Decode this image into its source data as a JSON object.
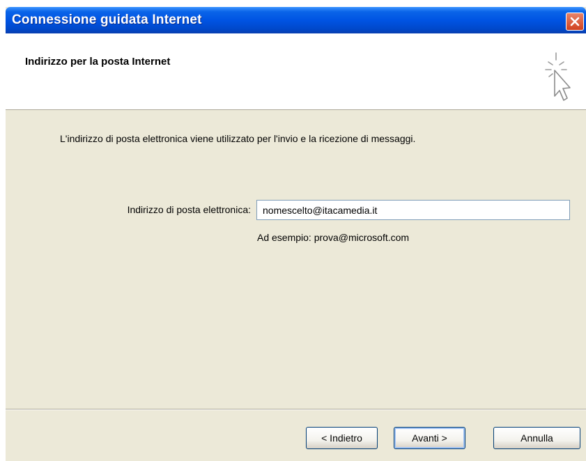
{
  "window": {
    "title": "Connessione guidata Internet"
  },
  "header": {
    "title": "Indirizzo per la posta Internet"
  },
  "content": {
    "description": "L'indirizzo di posta elettronica viene utilizzato per l'invio e la ricezione di messaggi.",
    "email_label": "Indirizzo di posta elettronica:",
    "email_value": "nomescelto@itacamedia.it",
    "example": "Ad esempio: prova@microsoft.com"
  },
  "buttons": {
    "back": "< Indietro",
    "next": "Avanti >",
    "cancel": "Annulla"
  },
  "colors": {
    "titlebar": "#0054e3",
    "body": "#ece9d8",
    "close": "#d1411e"
  },
  "icons": {
    "close": "close-icon",
    "wizard": "cursor-sparkle-icon"
  }
}
